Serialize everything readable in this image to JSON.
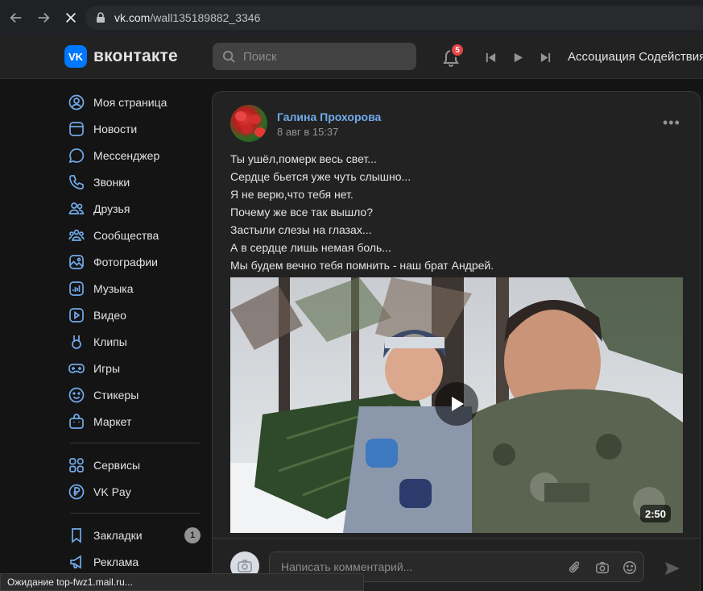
{
  "browser": {
    "url_host": "vk.com",
    "url_path": "/wall135189882_3346"
  },
  "header": {
    "logo_text": "вконтакте",
    "search_placeholder": "Поиск",
    "notifications_count": "5",
    "now_playing": "Ассоциация Содействия"
  },
  "sidebar": {
    "items": [
      {
        "label": "Моя страница",
        "icon": "user-circle-icon"
      },
      {
        "label": "Новости",
        "icon": "news-icon"
      },
      {
        "label": "Мессенджер",
        "icon": "messenger-icon"
      },
      {
        "label": "Звонки",
        "icon": "phone-icon"
      },
      {
        "label": "Друзья",
        "icon": "friends-icon"
      },
      {
        "label": "Сообщества",
        "icon": "communities-icon"
      },
      {
        "label": "Фотографии",
        "icon": "photos-icon"
      },
      {
        "label": "Музыка",
        "icon": "music-icon"
      },
      {
        "label": "Видео",
        "icon": "video-icon"
      },
      {
        "label": "Клипы",
        "icon": "clips-icon"
      },
      {
        "label": "Игры",
        "icon": "games-icon"
      },
      {
        "label": "Стикеры",
        "icon": "stickers-icon"
      },
      {
        "label": "Маркет",
        "icon": "market-icon"
      }
    ],
    "services": [
      {
        "label": "Сервисы",
        "icon": "services-icon"
      },
      {
        "label": "VK Pay",
        "icon": "vkpay-icon"
      }
    ],
    "extra": [
      {
        "label": "Закладки",
        "icon": "bookmark-icon",
        "count": "1"
      },
      {
        "label": "Реклама",
        "icon": "megaphone-icon"
      }
    ]
  },
  "post": {
    "author": "Галина Прохорова",
    "date": "8 авг в 15:37",
    "text_lines": [
      "Ты ушёл,померк весь свет...",
      "Сердце бьется уже чуть слышно...",
      "Я не верю,что тебя нет.",
      "Почему же все так вышло?",
      "Застыли слезы на глазах...",
      "А в сердце лишь немая боль...",
      "Мы будем вечно тебя помнить - наш брат Андрей."
    ],
    "video_duration": "2:50",
    "comment_placeholder": "Написать комментарий..."
  },
  "status_bar": {
    "text": "Ожидание top-fwz1.mail.ru..."
  },
  "colors": {
    "accent": "#71aaeb",
    "brand": "#0077ff",
    "badge": "#e64646"
  }
}
